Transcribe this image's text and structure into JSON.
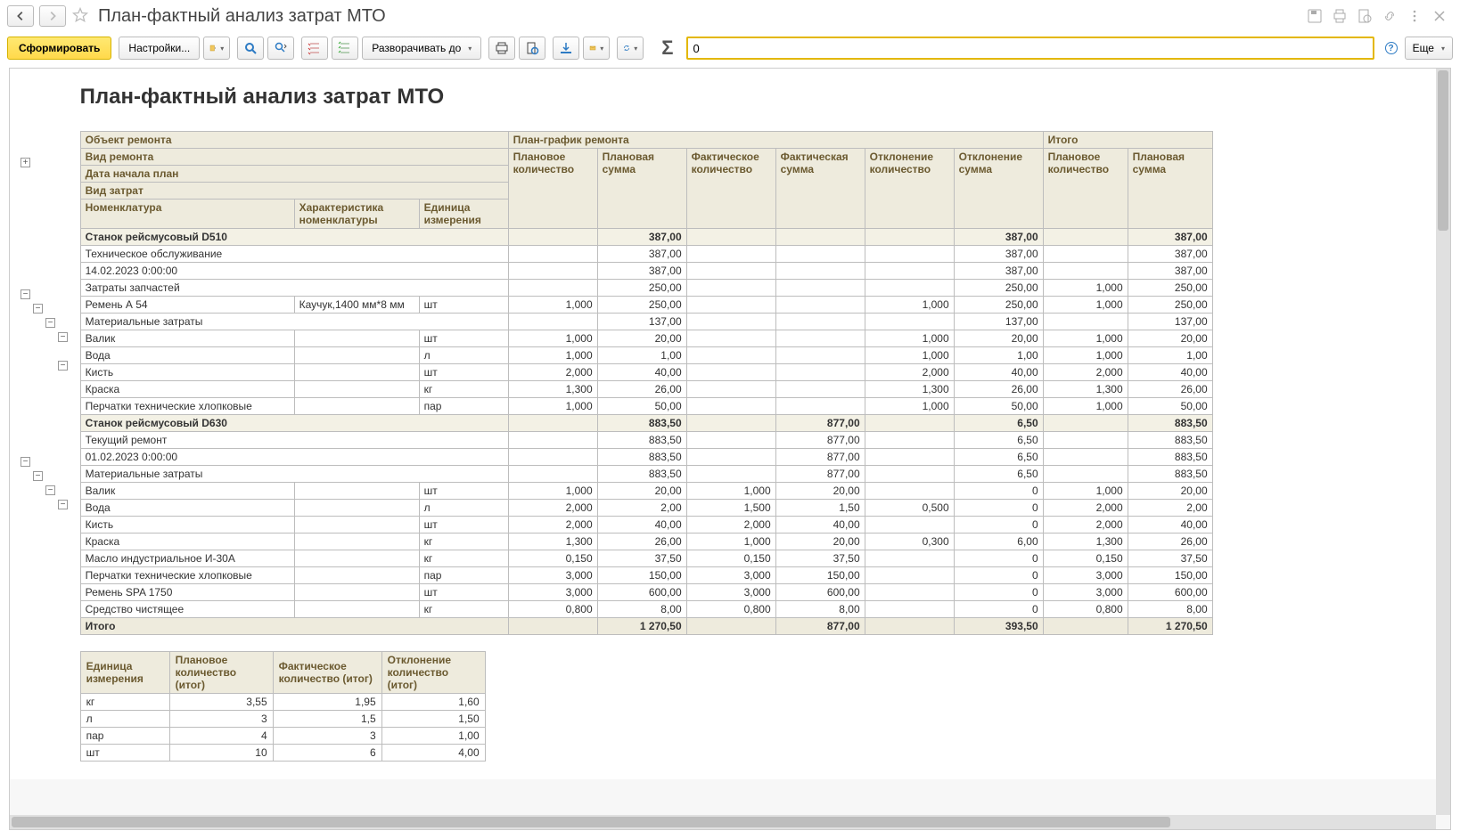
{
  "window": {
    "title": "План-фактный анализ затрат МТО"
  },
  "toolbar": {
    "generate": "Сформировать",
    "settings": "Настройки...",
    "unfold_to": "Разворачивать до",
    "sum_value": "0",
    "more": "Еще"
  },
  "report": {
    "title": "План-фактный анализ затрат МТО",
    "headers": {
      "object": "Объект ремонта",
      "repair_type": "Вид ремонта",
      "date_plan": "Дата начала план",
      "cost_type": "Вид затрат",
      "nomen": "Номенклатура",
      "char": "Характеристика номенклатуры",
      "unit": "Единица измерения",
      "sched": "План-график ремонта",
      "total": "Итого",
      "plan_qty": "Плановое количество",
      "plan_sum": "Плановая сумма",
      "fact_qty": "Фактическое количество",
      "fact_sum": "Фактическая сумма",
      "dev_qty": "Отклонение количество",
      "dev_sum": "Отклонение сумма"
    },
    "rows": [
      {
        "lvl": 0,
        "name": "Станок рейсмусовый D510",
        "psum": "387,00",
        "dsum": "387,00",
        "tsum": "387,00"
      },
      {
        "lvl": 1,
        "name": "Техническое обслуживание",
        "psum": "387,00",
        "dsum": "387,00",
        "tsum": "387,00"
      },
      {
        "lvl": 2,
        "name": "14.02.2023 0:00:00",
        "psum": "387,00",
        "dsum": "387,00",
        "tsum": "387,00"
      },
      {
        "lvl": 3,
        "name": "Затраты запчастей",
        "psum": "250,00",
        "dsum": "250,00",
        "tpqty": "1,000",
        "tsum": "250,00"
      },
      {
        "lvl": 4,
        "name": "Ремень А 54",
        "char": "Каучук,1400 мм*8 мм",
        "unit": "шт",
        "pqty": "1,000",
        "psum": "250,00",
        "dqty": "1,000",
        "dsum": "250,00",
        "tpqty": "1,000",
        "tsum": "250,00"
      },
      {
        "lvl": 3,
        "name": "Материальные затраты",
        "psum": "137,00",
        "dsum": "137,00",
        "tsum": "137,00"
      },
      {
        "lvl": 4,
        "name": "Валик",
        "unit": "шт",
        "pqty": "1,000",
        "psum": "20,00",
        "dqty": "1,000",
        "dsum": "20,00",
        "tpqty": "1,000",
        "tsum": "20,00"
      },
      {
        "lvl": 4,
        "name": "Вода",
        "unit": "л",
        "pqty": "1,000",
        "psum": "1,00",
        "dqty": "1,000",
        "dsum": "1,00",
        "tpqty": "1,000",
        "tsum": "1,00"
      },
      {
        "lvl": 4,
        "name": "Кисть",
        "unit": "шт",
        "pqty": "2,000",
        "psum": "40,00",
        "dqty": "2,000",
        "dsum": "40,00",
        "tpqty": "2,000",
        "tsum": "40,00"
      },
      {
        "lvl": 4,
        "name": "Краска",
        "unit": "кг",
        "pqty": "1,300",
        "psum": "26,00",
        "dqty": "1,300",
        "dsum": "26,00",
        "tpqty": "1,300",
        "tsum": "26,00"
      },
      {
        "lvl": 4,
        "name": "Перчатки технические хлопковые",
        "unit": "пар",
        "pqty": "1,000",
        "psum": "50,00",
        "dqty": "1,000",
        "dsum": "50,00",
        "tpqty": "1,000",
        "tsum": "50,00"
      },
      {
        "lvl": 0,
        "name": "Станок рейсмусовый D630",
        "psum": "883,50",
        "fsum": "877,00",
        "dsum": "6,50",
        "tsum": "883,50"
      },
      {
        "lvl": 1,
        "name": "Текущий ремонт",
        "psum": "883,50",
        "fsum": "877,00",
        "dsum": "6,50",
        "tsum": "883,50"
      },
      {
        "lvl": 2,
        "name": "01.02.2023 0:00:00",
        "psum": "883,50",
        "fsum": "877,00",
        "dsum": "6,50",
        "tsum": "883,50"
      },
      {
        "lvl": 3,
        "name": "Материальные затраты",
        "psum": "883,50",
        "fsum": "877,00",
        "dsum": "6,50",
        "tsum": "883,50"
      },
      {
        "lvl": 4,
        "name": "Валик",
        "unit": "шт",
        "pqty": "1,000",
        "psum": "20,00",
        "fqty": "1,000",
        "fsum": "20,00",
        "dsum": "0",
        "tpqty": "1,000",
        "tsum": "20,00"
      },
      {
        "lvl": 4,
        "name": "Вода",
        "unit": "л",
        "pqty": "2,000",
        "psum": "2,00",
        "fqty": "1,500",
        "fsum": "1,50",
        "dqty": "0,500",
        "dsum": "0",
        "tpqty": "2,000",
        "tsum": "2,00"
      },
      {
        "lvl": 4,
        "name": "Кисть",
        "unit": "шт",
        "pqty": "2,000",
        "psum": "40,00",
        "fqty": "2,000",
        "fsum": "40,00",
        "dsum": "0",
        "tpqty": "2,000",
        "tsum": "40,00"
      },
      {
        "lvl": 4,
        "name": "Краска",
        "unit": "кг",
        "pqty": "1,300",
        "psum": "26,00",
        "fqty": "1,000",
        "fsum": "20,00",
        "dqty": "0,300",
        "dsum": "6,00",
        "tpqty": "1,300",
        "tsum": "26,00"
      },
      {
        "lvl": 4,
        "name": "Масло индустриальное И-30А",
        "unit": "кг",
        "pqty": "0,150",
        "psum": "37,50",
        "fqty": "0,150",
        "fsum": "37,50",
        "dsum": "0",
        "tpqty": "0,150",
        "tsum": "37,50"
      },
      {
        "lvl": 4,
        "name": "Перчатки технические хлопковые",
        "unit": "пар",
        "pqty": "3,000",
        "psum": "150,00",
        "fqty": "3,000",
        "fsum": "150,00",
        "dsum": "0",
        "tpqty": "3,000",
        "tsum": "150,00"
      },
      {
        "lvl": 4,
        "name": "Ремень SPA 1750",
        "unit": "шт",
        "pqty": "3,000",
        "psum": "600,00",
        "fqty": "3,000",
        "fsum": "600,00",
        "dsum": "0",
        "tpqty": "3,000",
        "tsum": "600,00"
      },
      {
        "lvl": 4,
        "name": "Средство чистящее",
        "unit": "кг",
        "pqty": "0,800",
        "psum": "8,00",
        "fqty": "0,800",
        "fsum": "8,00",
        "dsum": "0",
        "tpqty": "0,800",
        "tsum": "8,00"
      }
    ],
    "grand_total": {
      "name": "Итого",
      "psum": "1 270,50",
      "fsum": "877,00",
      "dsum": "393,50",
      "tsum": "1 270,50"
    },
    "summary_headers": {
      "unit": "Единица измерения",
      "pqty": "Плановое количество (итог)",
      "fqty": "Фактическое количество (итог)",
      "dqty": "Отклонение количество (итог)"
    },
    "summary": [
      {
        "unit": "кг",
        "p": "3,55",
        "f": "1,95",
        "d": "1,60"
      },
      {
        "unit": "л",
        "p": "3",
        "f": "1,5",
        "d": "1,50"
      },
      {
        "unit": "пар",
        "p": "4",
        "f": "3",
        "d": "1,00"
      },
      {
        "unit": "шт",
        "p": "10",
        "f": "6",
        "d": "4,00"
      }
    ]
  }
}
